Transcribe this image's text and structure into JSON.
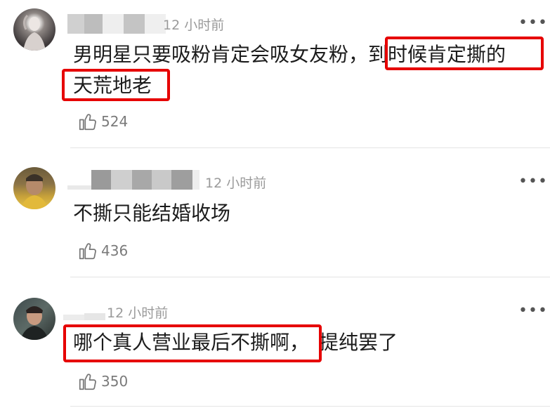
{
  "comments": [
    {
      "time": "12 小时前",
      "text_normal": "男明星只要吸粉肯定会吸女友粉，",
      "text_highlight_1": "到时候肯定撕的",
      "text_highlight_2": "天荒地老",
      "likes": "524",
      "more": "•••"
    },
    {
      "time": "12 小时前",
      "text_normal": "不撕只能结婚收场",
      "likes": "436",
      "more": "•••"
    },
    {
      "time": "12 小时前",
      "text_highlight_1": "哪个真人营业最后不撕啊，",
      "text_normal": "提纯罢了",
      "likes": "350",
      "more": "•••"
    }
  ],
  "colors": {
    "highlight_border": "#e60000",
    "timestamp": "#9a9a9a",
    "divider": "#e4e4e4"
  },
  "icons": [
    "thumbs-up-icon",
    "more-options-icon"
  ]
}
